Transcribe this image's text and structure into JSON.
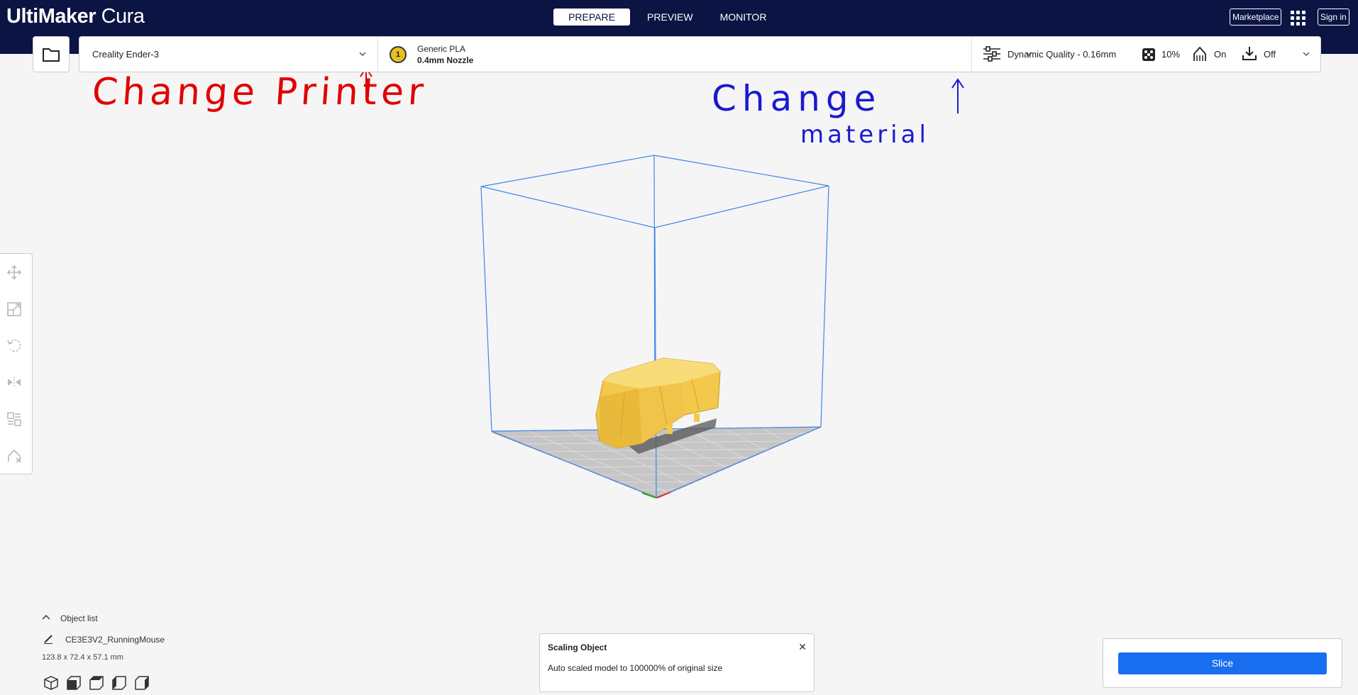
{
  "app": {
    "logo_bold": "UltiMaker",
    "logo_light": " Cura"
  },
  "stages": [
    "PREPARE",
    "PREVIEW",
    "MONITOR"
  ],
  "header": {
    "marketplace": "Marketplace",
    "sign_in": "Sign in"
  },
  "printer": {
    "name": "Creality Ender-3"
  },
  "extruder": {
    "number": "1",
    "material": "Generic PLA",
    "nozzle": "0.4mm Nozzle",
    "color": "#e8bf21"
  },
  "print_settings": {
    "profile": "Dynamic Quality - 0.16mm",
    "infill": "10%",
    "support": "On",
    "adhesion": "Off"
  },
  "object_list": {
    "title": "Object list",
    "object_name": "CE3E3V2_RunningMouse",
    "dimensions": "123.8 x 72.4 x 57.1 mm"
  },
  "message": {
    "title": "Scaling Object",
    "text": "Auto scaled model to 100000% of original size"
  },
  "slice_label": "Slice",
  "annotations": {
    "change_printer": "Change Printer",
    "change": "Change",
    "material": "material"
  },
  "colors": {
    "header": "#0b1443",
    "accent": "#196ef0",
    "annotation_red": "#e00000",
    "annotation_blue": "#1a1ad0",
    "model": "#f2c94c"
  }
}
